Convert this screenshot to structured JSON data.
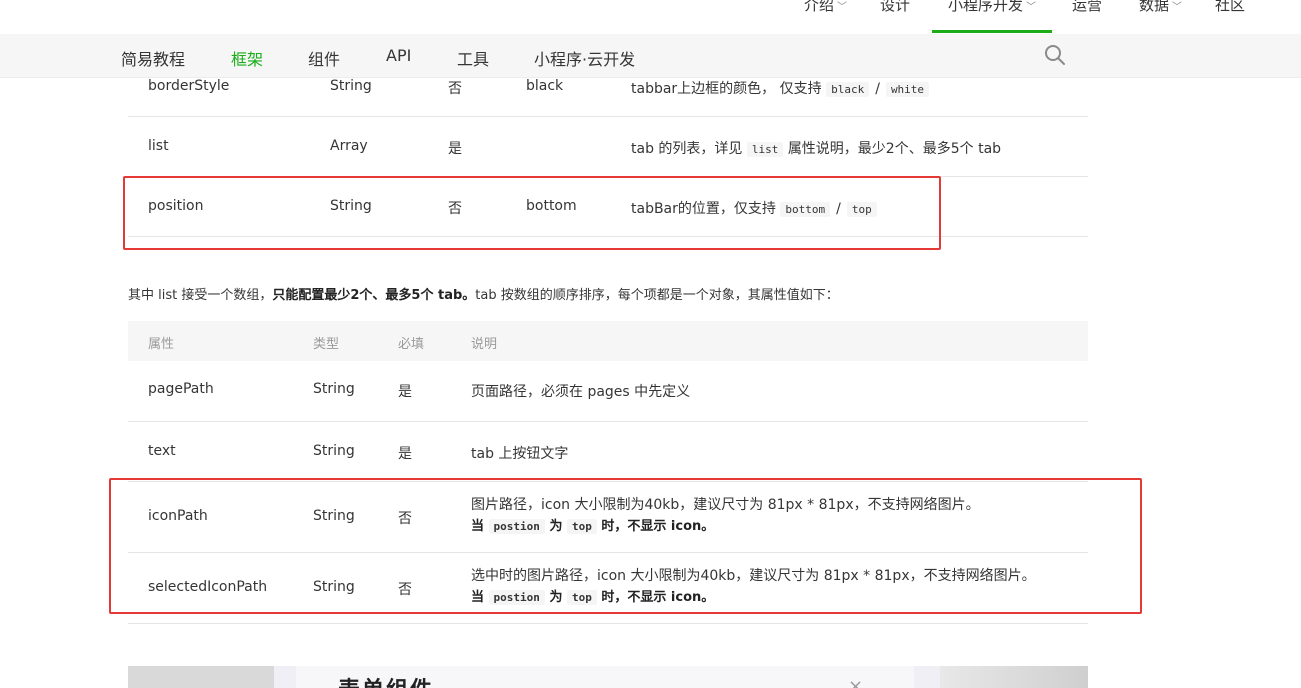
{
  "topnav": {
    "items": [
      {
        "label": "介绍",
        "chevron": true
      },
      {
        "label": "设计",
        "chevron": false
      },
      {
        "label": "小程序开发",
        "chevron": true
      },
      {
        "label": "运营",
        "chevron": false
      },
      {
        "label": "数据",
        "chevron": true
      },
      {
        "label": "社区",
        "chevron": false
      }
    ],
    "active": "小程序开发",
    "accent": "#1aad19"
  },
  "subnav": {
    "items": [
      "简易教程",
      "框架",
      "组件",
      "API",
      "工具",
      "小程序·云开发"
    ],
    "active": "框架"
  },
  "table1": {
    "rows": [
      {
        "name": "borderStyle",
        "type": "String",
        "required": "否",
        "default": "black",
        "desc_pre": "tabbar上边框的颜色， 仅支持",
        "code1": "black",
        "sep": "/",
        "code2": "white"
      },
      {
        "name": "list",
        "type": "Array",
        "required": "是",
        "default": "",
        "desc_pre": "tab 的列表，详见",
        "code1": "list",
        "desc_post": "属性说明，最少2个、最多5个 tab"
      },
      {
        "name": "position",
        "type": "String",
        "required": "否",
        "default": "bottom",
        "desc_pre": "tabBar的位置，仅支持",
        "code1": "bottom",
        "sep": "/",
        "code2": "top"
      }
    ]
  },
  "paragraph": {
    "pre": "其中 list 接受一个数组，",
    "bold": "只能配置最少2个、最多5个 tab。",
    "post": "tab 按数组的顺序排序，每个项都是一个对象，其属性值如下："
  },
  "table2": {
    "headers": [
      "属性",
      "类型",
      "必填",
      "说明"
    ],
    "rows": [
      {
        "name": "pagePath",
        "type": "String",
        "required": "是",
        "desc": "页面路径，必须在 pages 中先定义"
      },
      {
        "name": "text",
        "type": "String",
        "required": "是",
        "desc": "tab 上按钮文字"
      },
      {
        "name": "iconPath",
        "type": "String",
        "required": "否",
        "desc": "图片路径，icon 大小限制为40kb，建议尺寸为 81px * 81px，不支持网络图片。",
        "note_a": "当",
        "note_code1": "postion",
        "note_b": "为",
        "note_code2": "top",
        "note_c": "时，不显示 icon。"
      },
      {
        "name": "selectedIconPath",
        "type": "String",
        "required": "否",
        "desc": "选中时的图片路径，icon 大小限制为40kb，建议尺寸为 81px * 81px，不支持网络图片。",
        "note_a": "当",
        "note_code1": "postion",
        "note_b": "为",
        "note_code2": "top",
        "note_c": "时，不显示 icon。"
      }
    ]
  },
  "bottom_preview": {
    "title": "表单组件",
    "close": "×"
  }
}
